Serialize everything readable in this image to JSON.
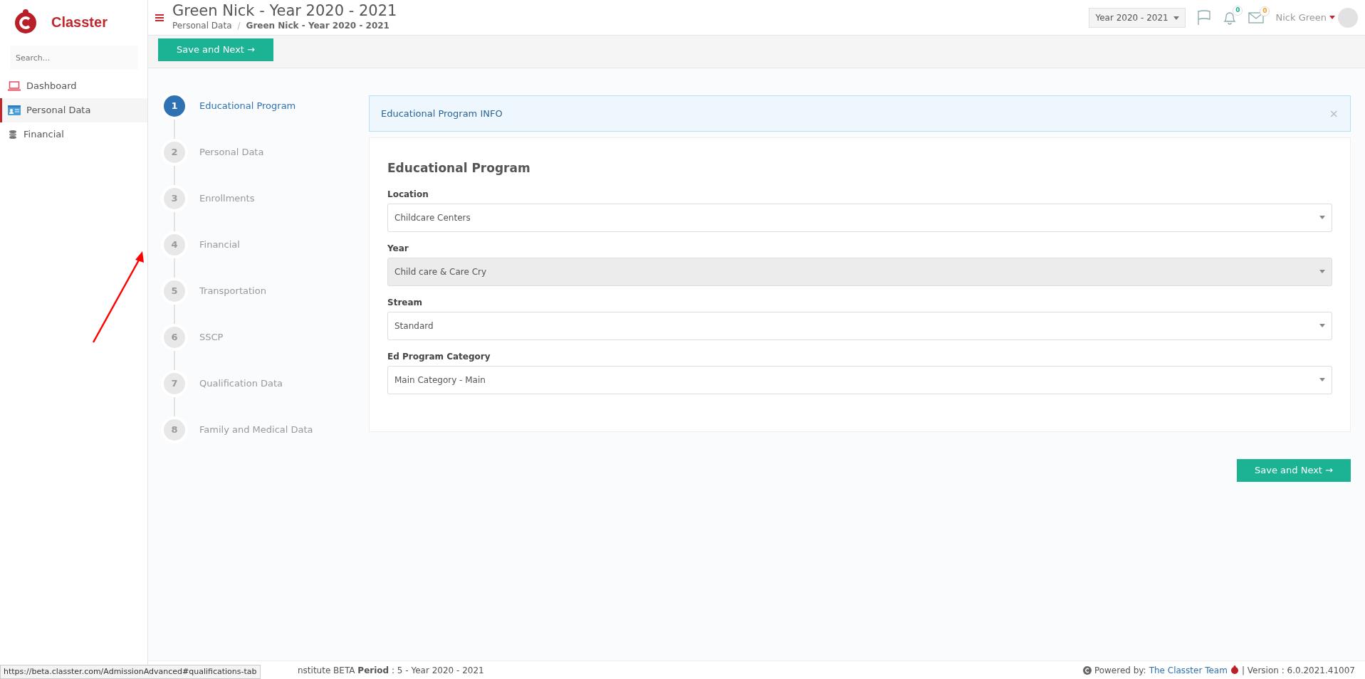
{
  "brand": {
    "name": "Classter"
  },
  "sidebar": {
    "search": {
      "placeholder": "Search..."
    },
    "items": [
      {
        "label": "Dashboard",
        "selected": false
      },
      {
        "label": "Personal Data",
        "selected": true
      },
      {
        "label": "Financial",
        "selected": false
      }
    ]
  },
  "header": {
    "title": "Green Nick - Year 2020 - 2021",
    "breadcrumb": [
      "Personal Data",
      "/",
      "Green Nick - Year 2020 - 2021"
    ],
    "year_select": "Year 2020 - 2021",
    "notifications": "0",
    "messages": "0",
    "user": "Nick Green"
  },
  "toolbar": {
    "button": "Save and Next →"
  },
  "steps": [
    {
      "number": "1",
      "label": "Educational Program",
      "selected": true
    },
    {
      "number": "2",
      "label": "Personal Data",
      "selected": false
    },
    {
      "number": "3",
      "label": "Enrollments",
      "selected": false
    },
    {
      "number": "4",
      "label": "Financial",
      "selected": false
    },
    {
      "number": "5",
      "label": "Transportation",
      "selected": false
    },
    {
      "number": "6",
      "label": "SSCP",
      "selected": false
    },
    {
      "number": "7",
      "label": "Qualification Data",
      "selected": false
    },
    {
      "number": "8",
      "label": "Family and Medical Data",
      "selected": false
    }
  ],
  "info_alert": {
    "text": "Educational Program INFO",
    "close": "×"
  },
  "form": {
    "title": "Educational Program",
    "fields": [
      {
        "label": "Location",
        "value": "Childcare Centers",
        "disabled": false
      },
      {
        "label": "Year",
        "value": "Child care & Care Cry",
        "disabled": true
      },
      {
        "label": "Stream",
        "value": "Standard",
        "disabled": false
      },
      {
        "label": "Ed Program Category",
        "value": "Main Category - Main",
        "disabled": false
      }
    ]
  },
  "save_button": "Save and Next →",
  "footer": {
    "left": "nstitute BETA **Period** : 5 - Year 2020 - 2021",
    "powered_by": "Powered by:",
    "team_link": "The Classter Team",
    "version": "| Version : 6.0.2021.41007"
  },
  "status_tooltip": "https://beta.classter.com/AdmissionAdvanced#qualifications-tab"
}
